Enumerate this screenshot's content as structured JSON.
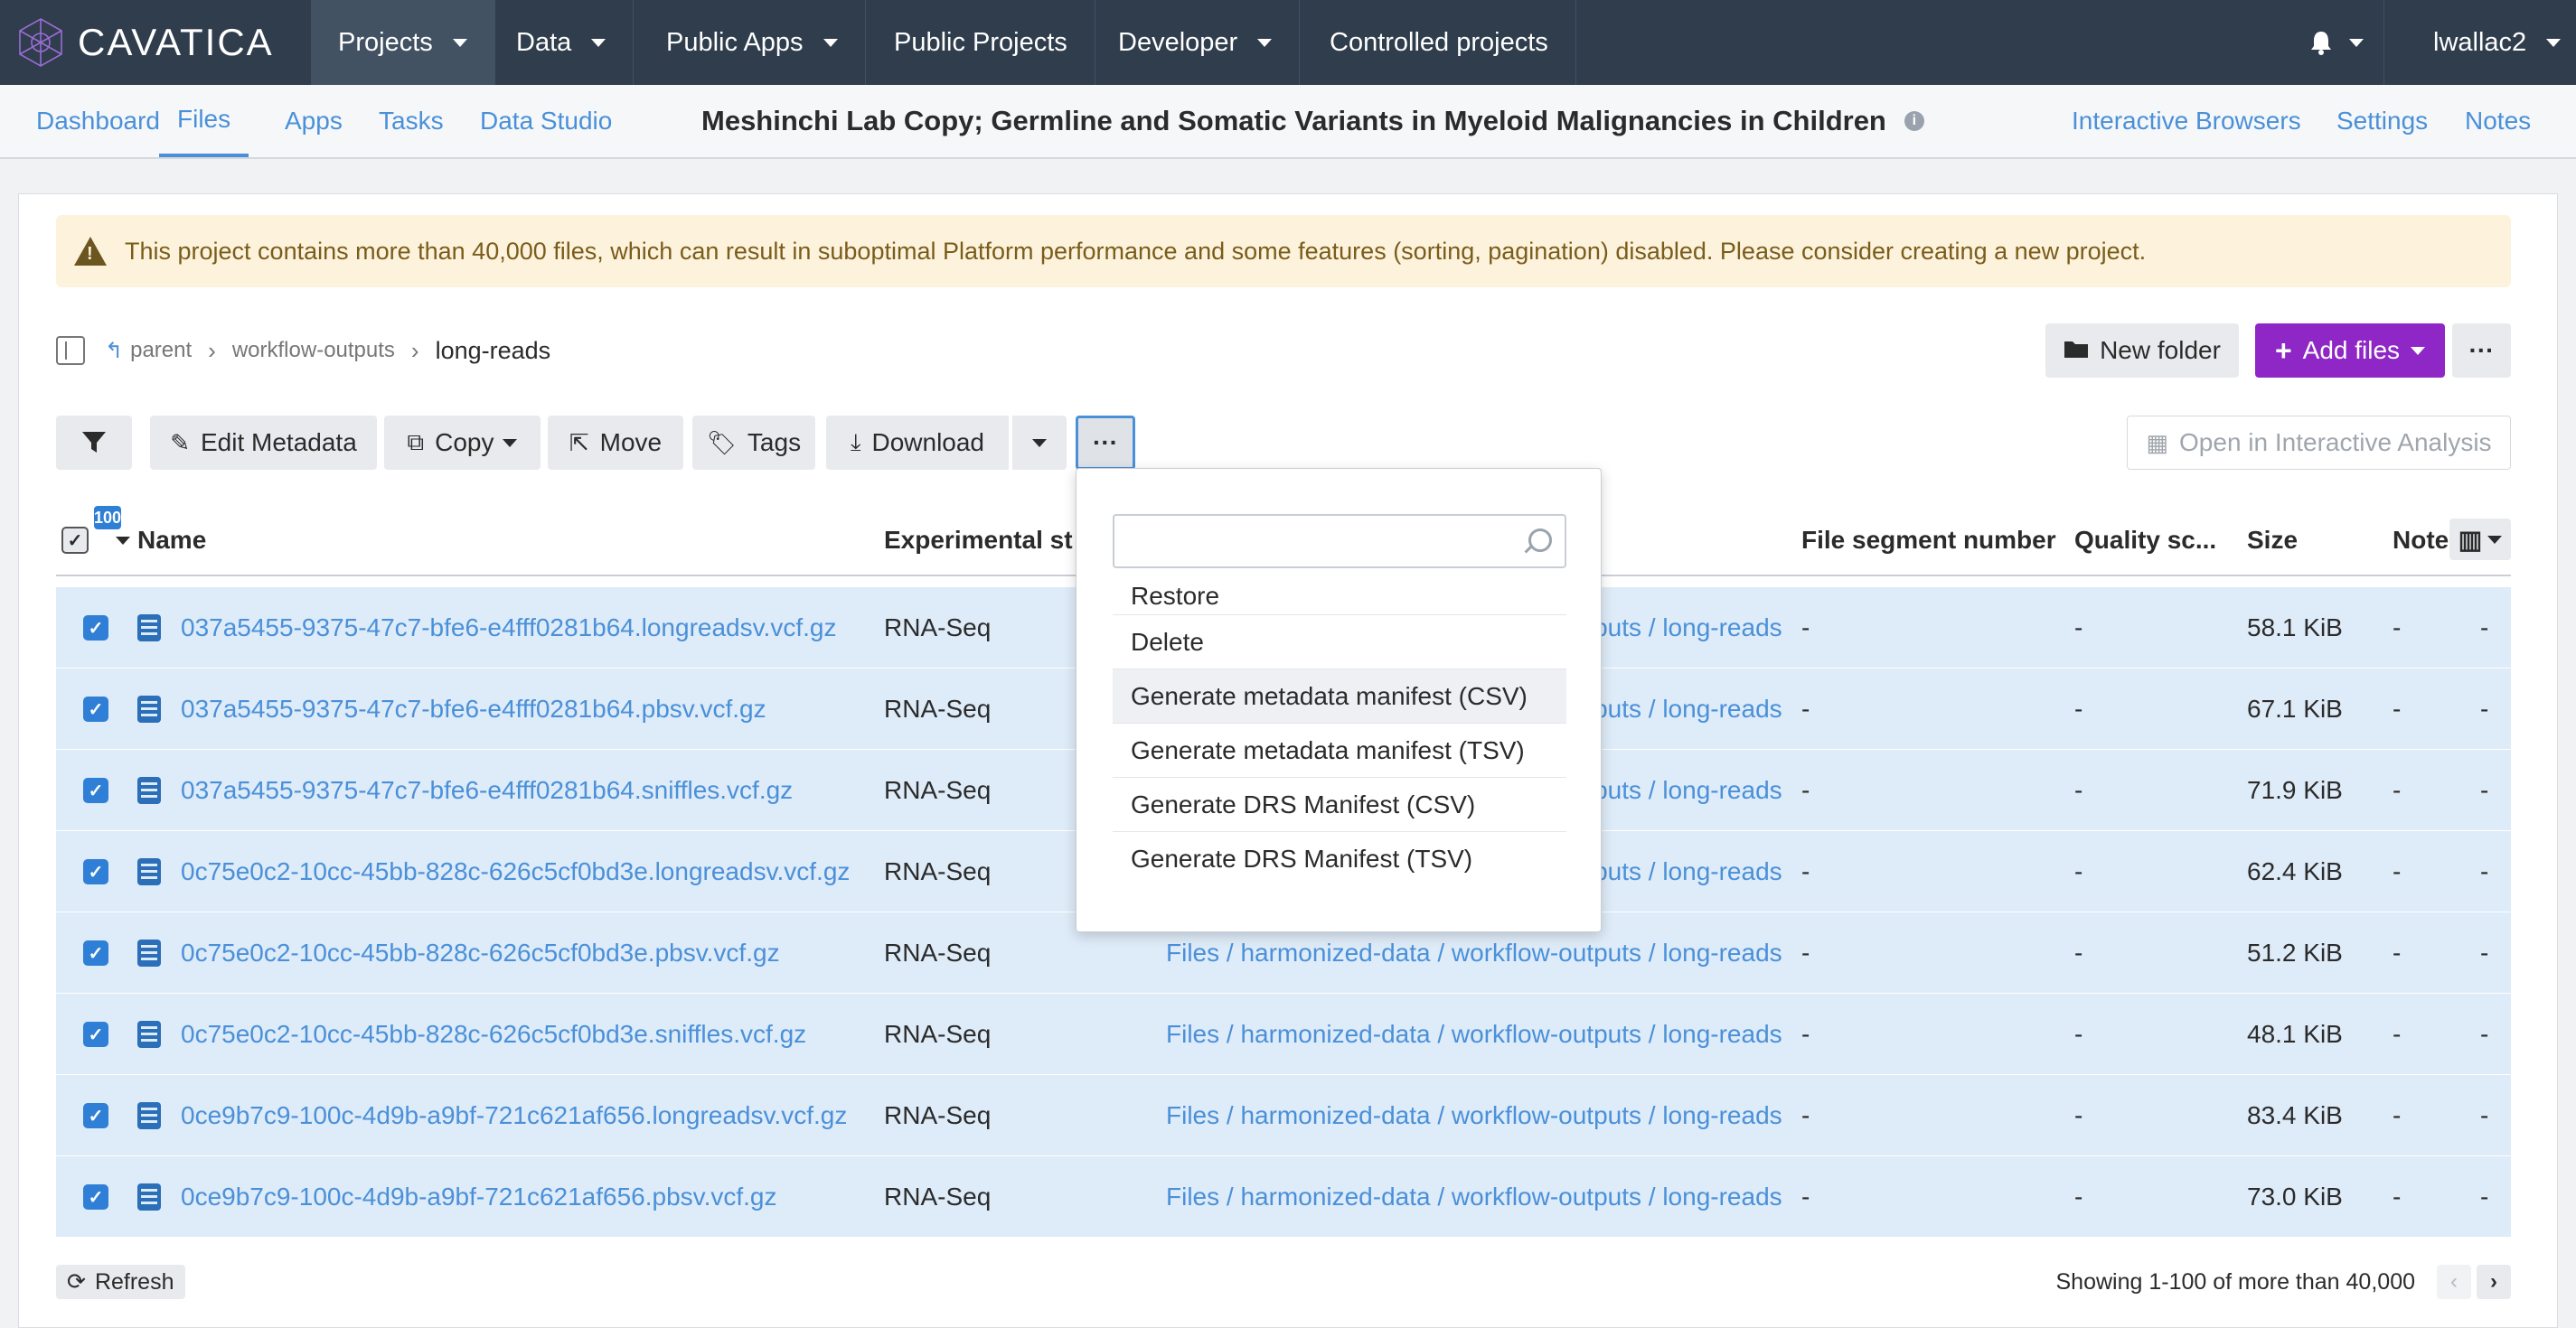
{
  "brand": {
    "name": "CAVATICA"
  },
  "topnav": {
    "items": [
      {
        "label": "Projects",
        "has_caret": true
      },
      {
        "label": "Data",
        "has_caret": true
      },
      {
        "label": "Public Apps",
        "has_caret": true
      },
      {
        "label": "Public Projects",
        "has_caret": false
      },
      {
        "label": "Developer",
        "has_caret": true
      },
      {
        "label": "Controlled projects",
        "has_caret": false
      }
    ],
    "user": "lwallac2",
    "bell_icon": "bell-icon"
  },
  "project": {
    "tabs": [
      "Dashboard",
      "Files",
      "Apps",
      "Tasks",
      "Data Studio"
    ],
    "active_tab": "Files",
    "title": "Meshinchi Lab Copy; Germline and Somatic Variants in Myeloid Malignancies in Children",
    "right_tabs": [
      "Interactive Browsers",
      "Settings",
      "Notes"
    ]
  },
  "warning": {
    "text": "This project contains more than 40,000 files, which can result in suboptimal Platform performance and some features (sorting, pagination) disabled. Please consider creating a new project."
  },
  "breadcrumb": {
    "parent": "parent",
    "middle": "workflow-outputs",
    "current": "long-reads"
  },
  "actions": {
    "new_folder": "New folder",
    "add_files": "Add files",
    "edit_metadata": "Edit Metadata",
    "copy": "Copy",
    "move": "Move",
    "tags": "Tags",
    "download": "Download",
    "open_interactive": "Open in Interactive Analysis"
  },
  "table": {
    "selected_count": "100",
    "columns": [
      "Name",
      "Experimental st",
      "File segment number",
      "Quality sc...",
      "Size",
      "Note"
    ],
    "rows": [
      {
        "name": "037a5455-9375-47c7-bfe6-e4fff0281b64.longreadsv.vcf.gz",
        "strategy": "RNA-Seq",
        "location": "Files / harmonized-data / workflow-outputs / long-reads",
        "segment": "-",
        "quality": "-",
        "size": "58.1 KiB",
        "note": "-",
        "extra": "-"
      },
      {
        "name": "037a5455-9375-47c7-bfe6-e4fff0281b64.pbsv.vcf.gz",
        "strategy": "RNA-Seq",
        "location": "Files / harmonized-data / workflow-outputs / long-reads",
        "segment": "-",
        "quality": "-",
        "size": "67.1 KiB",
        "note": "-",
        "extra": "-"
      },
      {
        "name": "037a5455-9375-47c7-bfe6-e4fff0281b64.sniffles.vcf.gz",
        "strategy": "RNA-Seq",
        "location": "Files / harmonized-data / workflow-outputs / long-reads",
        "segment": "-",
        "quality": "-",
        "size": "71.9 KiB",
        "note": "-",
        "extra": "-"
      },
      {
        "name": "0c75e0c2-10cc-45bb-828c-626c5cf0bd3e.longreadsv.vcf.gz",
        "strategy": "RNA-Seq",
        "location": "Files / harmonized-data / workflow-outputs / long-reads",
        "segment": "-",
        "quality": "-",
        "size": "62.4 KiB",
        "note": "-",
        "extra": "-"
      },
      {
        "name": "0c75e0c2-10cc-45bb-828c-626c5cf0bd3e.pbsv.vcf.gz",
        "strategy": "RNA-Seq",
        "location": "Files / harmonized-data / workflow-outputs / long-reads",
        "segment": "-",
        "quality": "-",
        "size": "51.2 KiB",
        "note": "-",
        "extra": "-"
      },
      {
        "name": "0c75e0c2-10cc-45bb-828c-626c5cf0bd3e.sniffles.vcf.gz",
        "strategy": "RNA-Seq",
        "location": "Files / harmonized-data / workflow-outputs / long-reads",
        "segment": "-",
        "quality": "-",
        "size": "48.1 KiB",
        "note": "-",
        "extra": "-"
      },
      {
        "name": "0ce9b7c9-100c-4d9b-a9bf-721c621af656.longreadsv.vcf.gz",
        "strategy": "RNA-Seq",
        "location": "Files / harmonized-data / workflow-outputs / long-reads",
        "segment": "-",
        "quality": "-",
        "size": "83.4 KiB",
        "note": "-",
        "extra": "-"
      },
      {
        "name": "0ce9b7c9-100c-4d9b-a9bf-721c621af656.pbsv.vcf.gz",
        "strategy": "RNA-Seq",
        "location": "Files / harmonized-data / workflow-outputs / long-reads",
        "segment": "-",
        "quality": "-",
        "size": "73.0 KiB",
        "note": "-",
        "extra": "-"
      }
    ]
  },
  "dropdown": {
    "items": [
      "Restore",
      "Delete",
      "Generate metadata manifest (CSV)",
      "Generate metadata manifest (TSV)",
      "Generate DRS Manifest (CSV)",
      "Generate DRS Manifest (TSV)"
    ],
    "hovered": "Generate metadata manifest (CSV)"
  },
  "footer": {
    "refresh": "Refresh",
    "showing": "Showing 1-100 of more than 40,000"
  },
  "colors": {
    "nav_bg": "#2f3d4c",
    "accent": "#4a90d9",
    "add_files": "#8e27c6",
    "row_selected": "#deebf8",
    "warning_bg": "#fdf3dc"
  }
}
